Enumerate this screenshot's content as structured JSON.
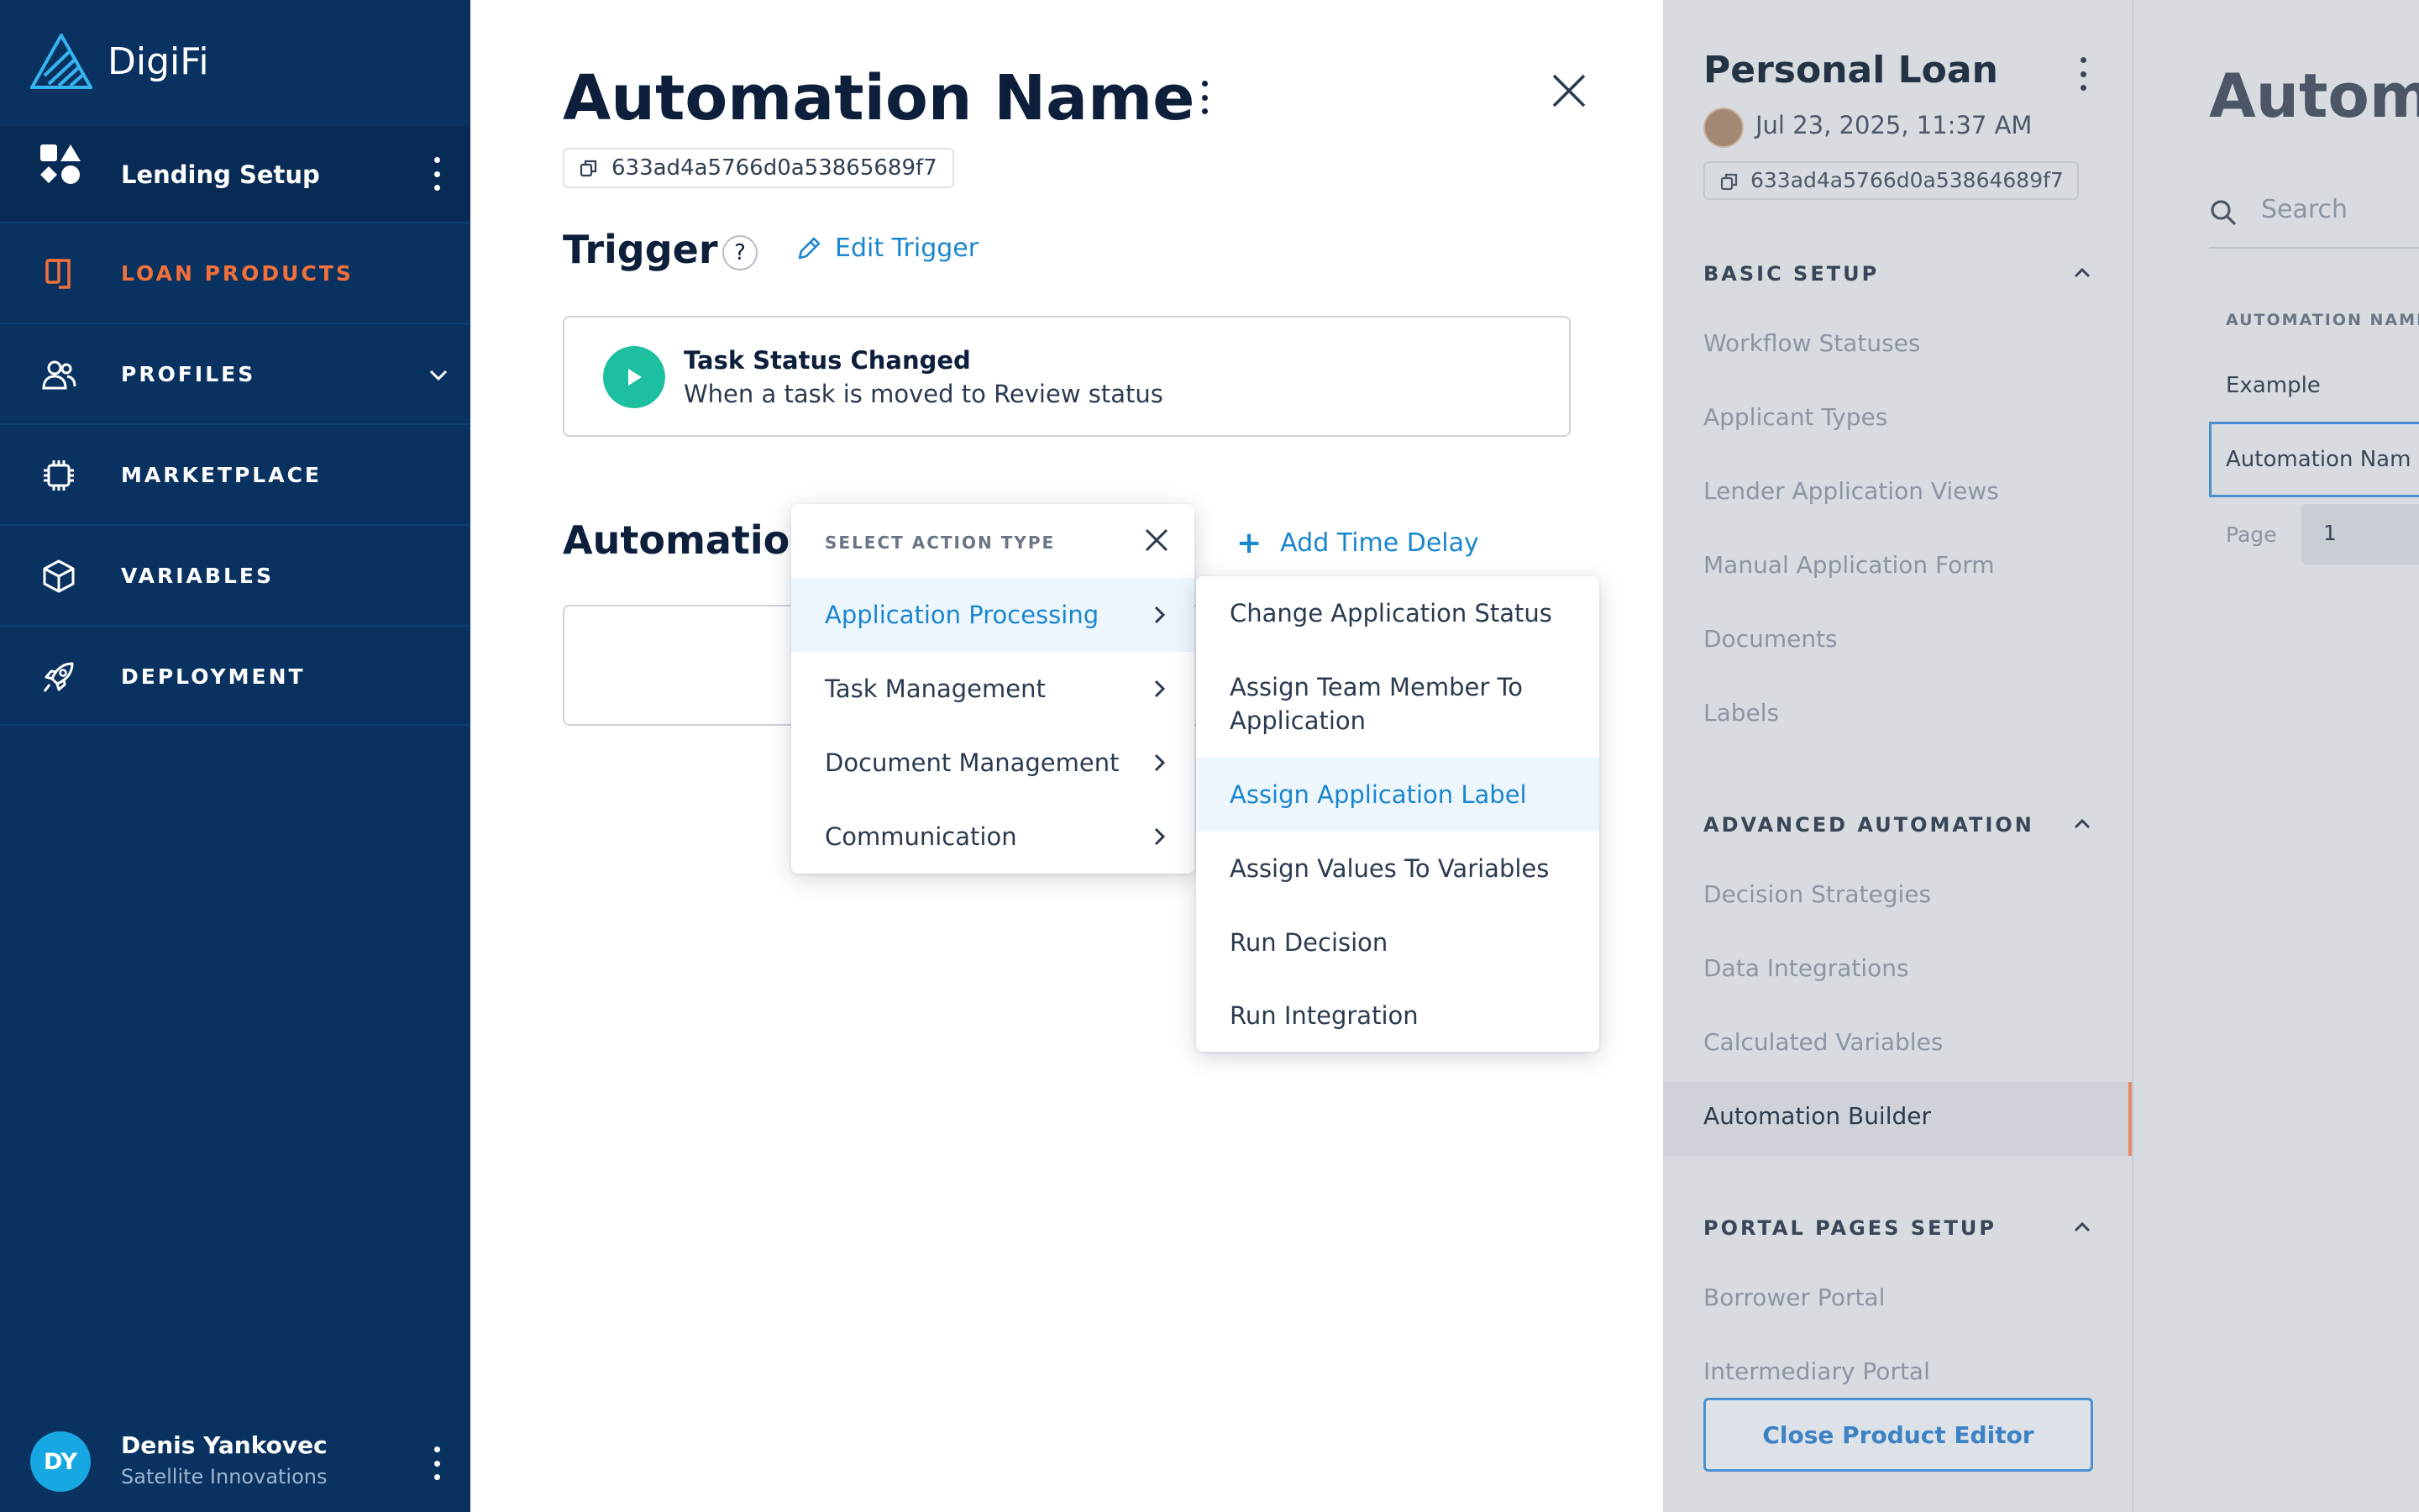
{
  "colors": {
    "sidebar": "#0a3261",
    "accent_orange": "#f2703a",
    "link_blue": "#1a86d0",
    "trigger_green": "#1cbfa0"
  },
  "sidebar": {
    "brand": "DigiFi",
    "workspace": "Lending Setup",
    "items": [
      {
        "label": "LOAN PRODUCTS",
        "icon": "loan-products-icon",
        "active": true
      },
      {
        "label": "PROFILES",
        "icon": "profiles-icon",
        "has_submenu": true
      },
      {
        "label": "MARKETPLACE",
        "icon": "chip-icon"
      },
      {
        "label": "VARIABLES",
        "icon": "cube-icon"
      },
      {
        "label": "DEPLOYMENT",
        "icon": "rocket-icon"
      }
    ],
    "user": {
      "initials": "DY",
      "name": "Denis Yankovec",
      "org": "Satellite Innovations"
    }
  },
  "editor": {
    "title": "Automation Name",
    "id": "633ad4a5766d0a53865689f7",
    "trigger_heading": "Trigger",
    "help": "?",
    "edit_trigger": "Edit Trigger",
    "trigger": {
      "name": "Task Status Changed",
      "description": "When a task is moved to Review status"
    },
    "automation_heading": "Automation",
    "add_time_delay": "Add Time Delay"
  },
  "action_menu": {
    "header": "SELECT ACTION TYPE",
    "categories": [
      "Application Processing",
      "Task Management",
      "Document Management",
      "Communication"
    ],
    "selected_category": "Application Processing",
    "actions": [
      "Change Application Status",
      "Assign Team Member To Application",
      "Assign Application Label",
      "Assign Values To Variables",
      "Run Decision",
      "Run Integration"
    ],
    "highlighted_action": "Assign Application Label"
  },
  "product_panel": {
    "title": "Personal Loan",
    "date": "Jul 23, 2025, 11:37 AM",
    "id": "633ad4a5766d0a53864689f7",
    "sections": [
      {
        "title": "BASIC SETUP",
        "links": [
          "Workflow Statuses",
          "Applicant Types",
          "Lender Application Views",
          "Manual Application Form",
          "Documents",
          "Labels"
        ]
      },
      {
        "title": "ADVANCED AUTOMATION",
        "links": [
          "Decision Strategies",
          "Data Integrations",
          "Calculated Variables",
          "Automation Builder"
        ]
      },
      {
        "title": "PORTAL PAGES SETUP",
        "links": [
          "Borrower Portal",
          "Intermediary Portal"
        ]
      }
    ],
    "current_link": "Automation Builder",
    "close_button": "Close Product Editor"
  },
  "background_page": {
    "title": "Autom",
    "search_placeholder": "Search",
    "column_header": "AUTOMATION NAMI",
    "rows": [
      "Example",
      "Automation Nam"
    ],
    "page_label": "Page",
    "page_value": "1"
  }
}
